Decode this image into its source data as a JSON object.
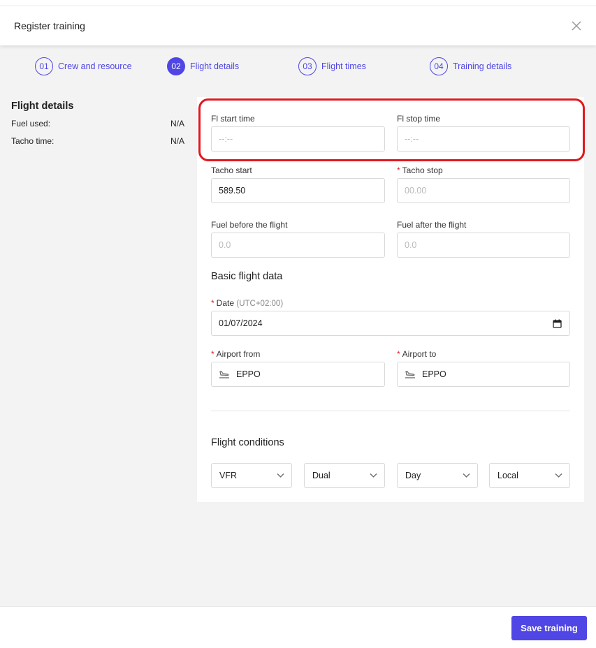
{
  "header": {
    "title": "Register training",
    "close_icon": "close-icon"
  },
  "steps": [
    {
      "num": "01",
      "label": "Crew and resource",
      "active": false
    },
    {
      "num": "02",
      "label": "Flight details",
      "active": true
    },
    {
      "num": "03",
      "label": "Flight times",
      "active": false
    },
    {
      "num": "04",
      "label": "Training details",
      "active": false
    }
  ],
  "sidebar": {
    "title": "Flight details",
    "rows": [
      {
        "label": "Fuel used:",
        "value": "N/A"
      },
      {
        "label": "Tacho time:",
        "value": "N/A"
      }
    ]
  },
  "form": {
    "fl_start": {
      "label": "Fl start time",
      "placeholder": "--:--"
    },
    "fl_stop": {
      "label": "Fl stop time",
      "placeholder": "--:--"
    },
    "tacho_start": {
      "label": "Tacho start",
      "value": "589.50"
    },
    "tacho_stop": {
      "label": "Tacho stop",
      "placeholder": "00.00",
      "required": true
    },
    "fuel_before": {
      "label": "Fuel before the flight",
      "placeholder": "0.0"
    },
    "fuel_after": {
      "label": "Fuel after the flight",
      "placeholder": "0.0"
    },
    "basic_title": "Basic flight data",
    "date": {
      "label": "Date",
      "timezone": "(UTC+02:00)",
      "value": "01/07/2024",
      "required": true
    },
    "airport_from": {
      "label": "Airport from",
      "value": "EPPO",
      "required": true
    },
    "airport_to": {
      "label": "Airport to",
      "value": "EPPO",
      "required": true
    },
    "conditions_title": "Flight conditions",
    "conditions": [
      "VFR",
      "Dual",
      "Day",
      "Local"
    ]
  },
  "footer": {
    "save_label": "Save training"
  },
  "colors": {
    "accent": "#4f46e5",
    "required": "#dc2626",
    "highlight": "#e0181e"
  }
}
